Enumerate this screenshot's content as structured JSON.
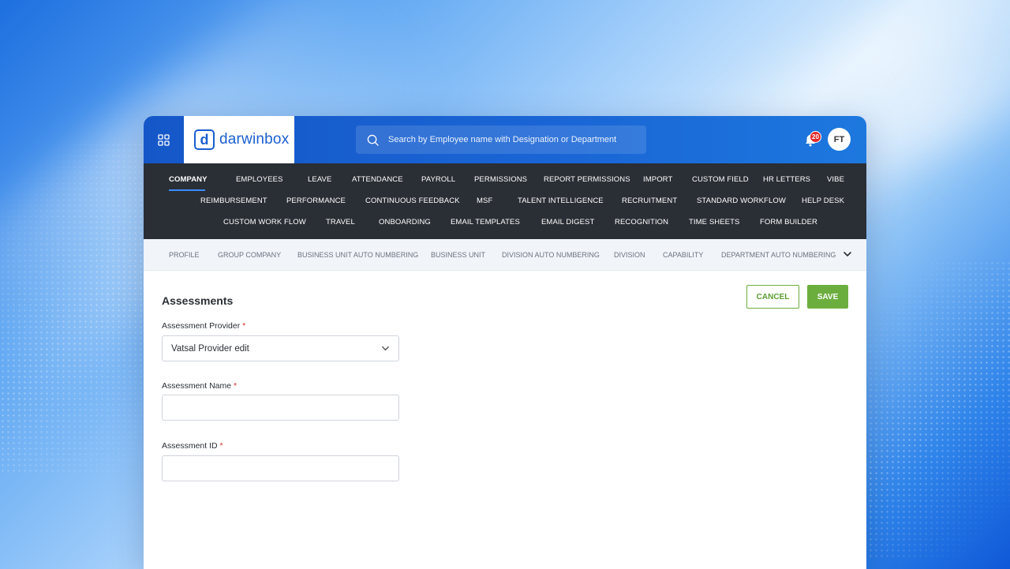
{
  "topbar": {
    "logo_text": "darwinbox",
    "logo_mark": "d",
    "search_placeholder": "Search by Employee name with Designation or Department",
    "notification_count": "20",
    "avatar_initials": "FT"
  },
  "main_nav": {
    "row1": [
      "COMPANY",
      "EMPLOYEES",
      "LEAVE",
      "ATTENDANCE",
      "PAYROLL",
      "PERMISSIONS",
      "REPORT PERMISSIONS",
      "IMPORT",
      "CUSTOM FIELD",
      "HR LETTERS",
      "VIBE"
    ],
    "row2": [
      "REIMBURSEMENT",
      "PERFORMANCE",
      "CONTINUOUS FEEDBACK",
      "MSF",
      "TALENT INTELLIGENCE",
      "RECRUITMENT",
      "STANDARD WORKFLOW",
      "HELP DESK"
    ],
    "row3": [
      "CUSTOM WORK FLOW",
      "TRAVEL",
      "ONBOARDING",
      "EMAIL TEMPLATES",
      "EMAIL DIGEST",
      "RECOGNITION",
      "TIME SHEETS",
      "FORM BUILDER"
    ],
    "active": "COMPANY"
  },
  "sub_nav": [
    "PROFILE",
    "GROUP COMPANY",
    "BUSINESS UNIT AUTO NUMBERING",
    "BUSINESS UNIT",
    "DIVISION AUTO NUMBERING",
    "DIVISION",
    "CAPABILITY",
    "DEPARTMENT AUTO NUMBERING"
  ],
  "form": {
    "title": "Assessments",
    "cancel_label": "CANCEL",
    "save_label": "SAVE",
    "required_mark": "*",
    "provider_label": "Assessment Provider",
    "provider_value": "Vatsal Provider edit",
    "name_label": "Assessment Name",
    "name_value": "",
    "id_label": "Assessment ID",
    "id_value": ""
  },
  "colors": {
    "topbar": "#1a66d6",
    "nav_bg": "#2a2e35",
    "accent_green": "#6cae3e",
    "badge_red": "#e02b2b"
  }
}
